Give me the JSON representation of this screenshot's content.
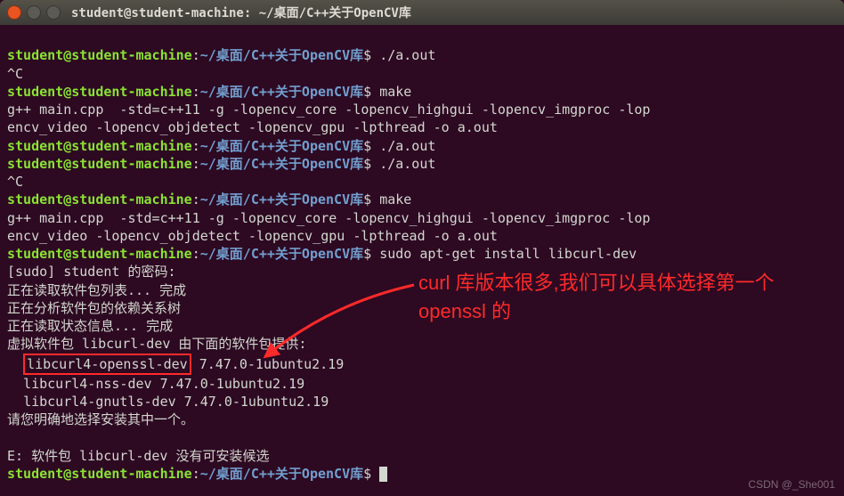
{
  "titlebar": {
    "title": "student@student-machine: ~/桌面/C++关于OpenCV库"
  },
  "prompt": {
    "userhost": "student@student-machine",
    "colon": ":",
    "path": "~/桌面/C++关于OpenCV库",
    "dollar": "$"
  },
  "lines": {
    "cmd1": "./a.out",
    "ctrlc": "^C",
    "cmd2": "make",
    "gpp1a": "g++ main.cpp  -std=c++11 -g -lopencv_core -lopencv_highgui -lopencv_imgproc -lop",
    "gpp1b": "encv_video -lopencv_objdetect -lopencv_gpu -lpthread -o a.out",
    "cmd3": "./a.out",
    "cmd4": "./a.out",
    "ctrlc2": "^C",
    "cmd5": "make",
    "gpp2a": "g++ main.cpp  -std=c++11 -g -lopencv_core -lopencv_highgui -lopencv_imgproc -lop",
    "gpp2b": "encv_video -lopencv_objdetect -lopencv_gpu -lpthread -o a.out",
    "cmd6": "sudo apt-get install libcurl-dev",
    "sudo": "[sudo] student 的密码:",
    "read1": "正在读取软件包列表... 完成",
    "read2": "正在分析软件包的依赖关系树",
    "read3": "正在读取状态信息... 完成",
    "virtpkg_a": "虚拟软件包 ",
    "virtpkg_b": "libcurl-dev",
    "virtpkg_c": " 由下面的软件包提供:",
    "opt1": "libcurl4-openssl-dev",
    "opt1v": " 7.47.0-1ubuntu2.19",
    "opt2": "  libcurl4-nss-dev 7.47.0-1ubuntu2.19",
    "opt3": "  libcurl4-gnutls-dev 7.47.0-1ubuntu2.19",
    "please": "请您明确地选择安装其中一个。",
    "err": "E: 软件包 libcurl-dev 没有可安装候选"
  },
  "annotation": {
    "text": "curl 库版本很多,我们可以具体选择第一个 openssl 的"
  },
  "watermark": "CSDN @_She001"
}
